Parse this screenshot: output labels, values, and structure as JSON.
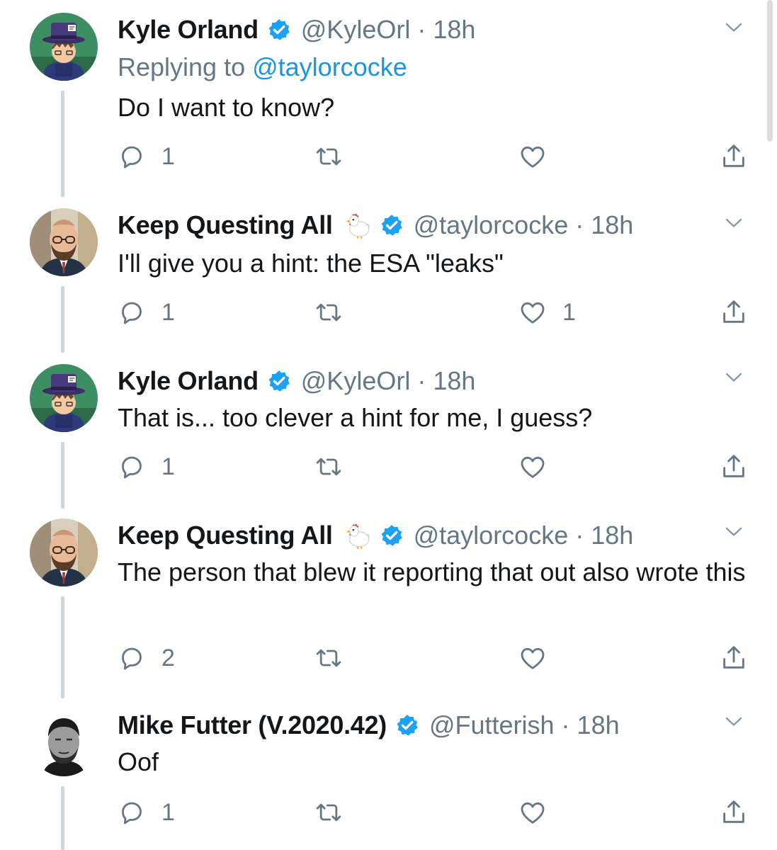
{
  "colors": {
    "text": "#14171a",
    "muted": "#657786",
    "link": "#1b95e0",
    "verified": "#1da1f2",
    "thread_line": "#ccd6dd"
  },
  "icons": {
    "reply": "speech-bubble-icon",
    "retweet": "retweet-icon",
    "like": "heart-icon",
    "share": "share-icon",
    "more": "chevron-down-icon",
    "verified": "verified-badge-icon",
    "emoji": "chicken-emoji"
  },
  "tweets": [
    {
      "name": "Kyle Orland",
      "handle": "@KyleOrl",
      "sep": "·",
      "time": "18h",
      "reply_prefix": "Replying to ",
      "reply_mention": "@taylorcocke",
      "text": "Do I want to know?",
      "reply_count": "1",
      "retweet_count": "",
      "like_count": ""
    },
    {
      "name": "Keep Questing All",
      "handle": "@taylorcocke",
      "sep": "·",
      "time": "18h",
      "text": "I'll give you a hint: the ESA \"leaks\"",
      "reply_count": "1",
      "retweet_count": "",
      "like_count": "1"
    },
    {
      "name": "Kyle Orland",
      "handle": "@KyleOrl",
      "sep": "·",
      "time": "18h",
      "text": "That is... too clever a hint for me, I guess?",
      "reply_count": "1",
      "retweet_count": "",
      "like_count": ""
    },
    {
      "name": "Keep Questing All",
      "handle": "@taylorcocke",
      "sep": "·",
      "time": "18h",
      "text": "The person that blew it reporting that out also wrote this",
      "reply_count": "2",
      "retweet_count": "",
      "like_count": ""
    },
    {
      "name": "Mike Futter (V.2020.42)",
      "handle": "@Futterish",
      "sep": "·",
      "time": "18h",
      "text": "Oof",
      "reply_count": "1",
      "retweet_count": "",
      "like_count": ""
    }
  ]
}
